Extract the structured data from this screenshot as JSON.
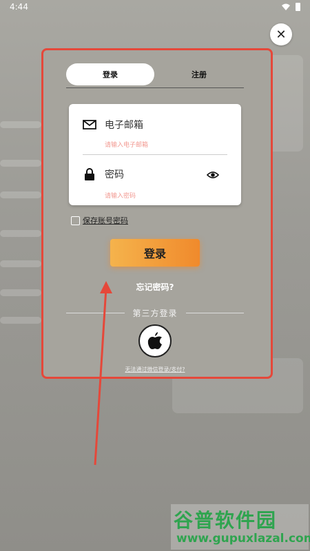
{
  "status_bar": {
    "time": "4:44"
  },
  "tabs": {
    "login": "登录",
    "register": "注册"
  },
  "form": {
    "email_label": "电子邮箱",
    "email_placeholder": "请输入电子邮箱",
    "password_label": "密码",
    "password_placeholder": "请输入密码"
  },
  "remember_label": "保存账号密码",
  "login_button": "登录",
  "forgot_password": "忘记密码?",
  "third_party_label": "第三方登录",
  "wechat_note": "无法通过微信登录/支付?",
  "watermark": {
    "title": "谷普软件园",
    "url": "www.gupuxlazal.com"
  },
  "colors": {
    "highlight_border": "#e5483a",
    "button_start": "#f5b34c",
    "button_end": "#f08a2c",
    "watermark": "#2fa44f"
  }
}
